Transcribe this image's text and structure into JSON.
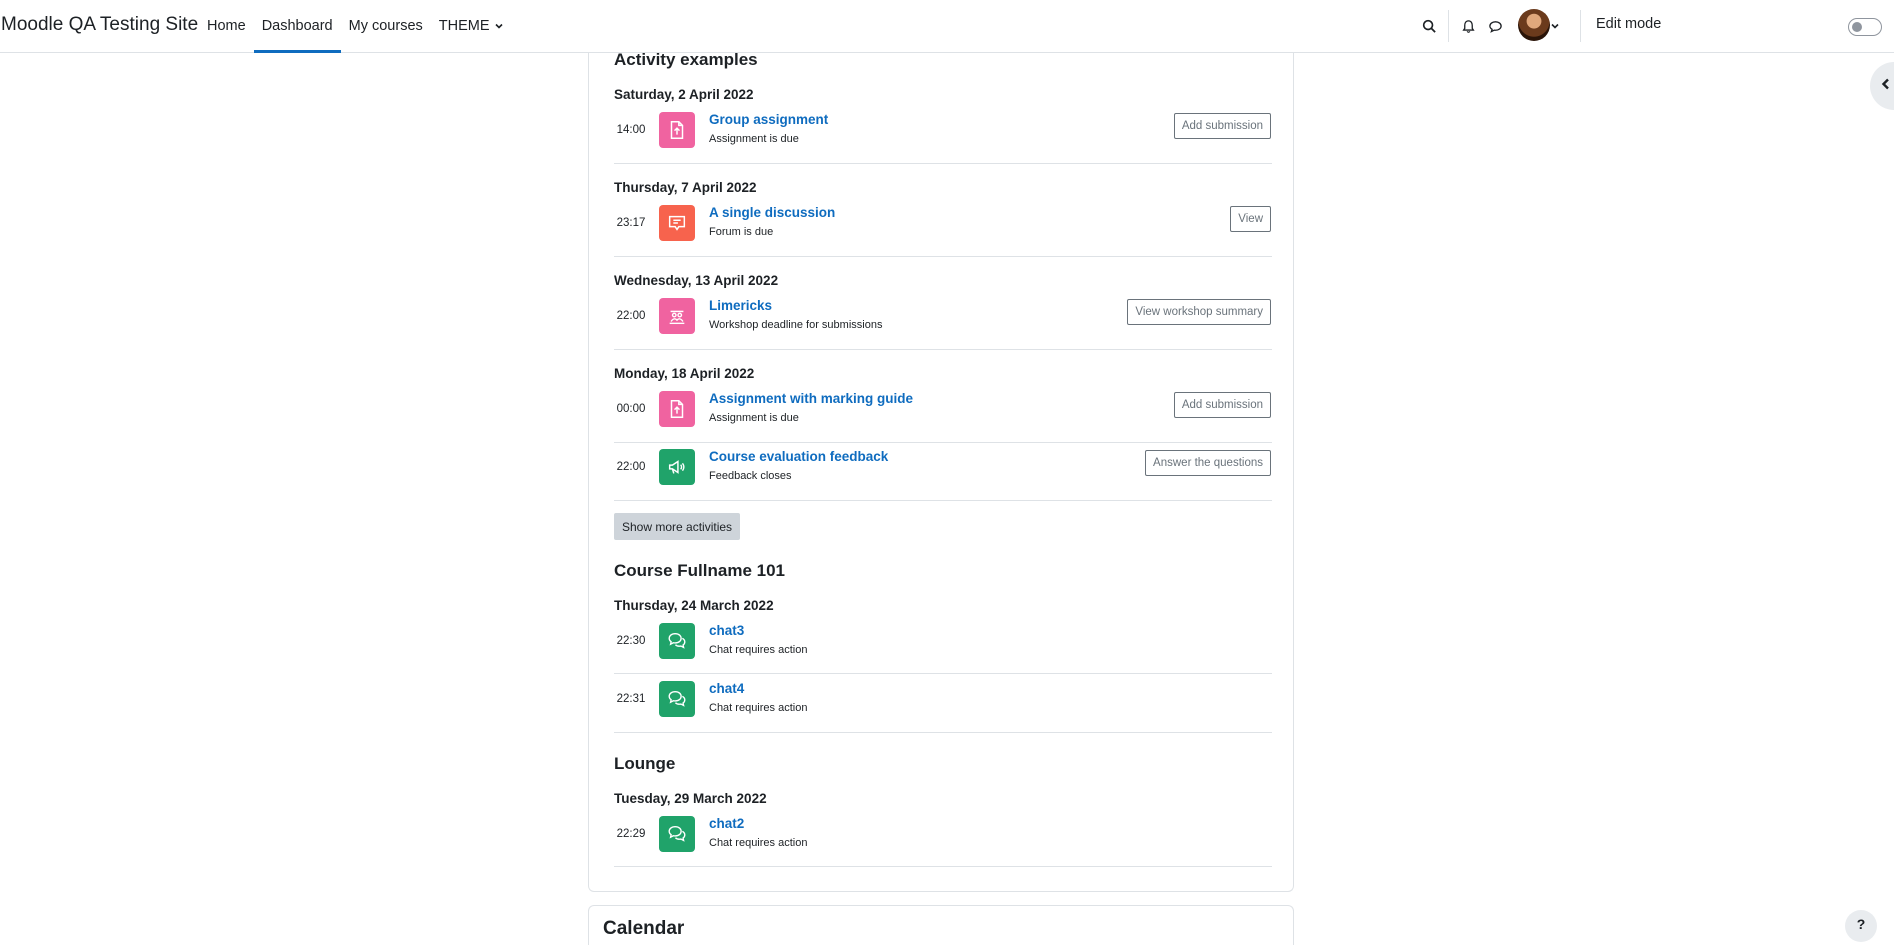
{
  "site_name": "Moodle QA Testing Site",
  "nav": {
    "items": [
      {
        "label": "Home",
        "active": false
      },
      {
        "label": "Dashboard",
        "active": true
      },
      {
        "label": "My courses",
        "active": false
      },
      {
        "label": "THEME",
        "active": false,
        "dropdown": true
      }
    ],
    "edit_mode_label": "Edit mode",
    "edit_mode_on": false
  },
  "colors": {
    "accent": "#0f6cbf",
    "assignment": "#f063a0",
    "forum": "#f7634d",
    "workshop": "#f063a0",
    "feedback": "#20a36a",
    "chat": "#20a36a"
  },
  "sections": [
    {
      "title": "Activity examples",
      "days": [
        {
          "date": "Saturday, 2 April 2022",
          "events": [
            {
              "time": "14:00",
              "icon": "assignment-icon",
              "name": "Group assignment",
              "desc": "Assignment is due",
              "action": "Add submission"
            }
          ]
        },
        {
          "date": "Thursday, 7 April 2022",
          "events": [
            {
              "time": "23:17",
              "icon": "forum-icon",
              "name": "A single discussion",
              "desc": "Forum is due",
              "action": "View"
            }
          ]
        },
        {
          "date": "Wednesday, 13 April 2022",
          "events": [
            {
              "time": "22:00",
              "icon": "workshop-icon",
              "name": "Limericks",
              "desc": "Workshop deadline for submissions",
              "action": "View workshop summary"
            }
          ]
        },
        {
          "date": "Monday, 18 April 2022",
          "events": [
            {
              "time": "00:00",
              "icon": "assignment-icon",
              "name": "Assignment with marking guide",
              "desc": "Assignment is due",
              "action": "Add submission"
            },
            {
              "time": "22:00",
              "icon": "feedback-icon",
              "name": "Course evaluation feedback",
              "desc": "Feedback closes",
              "action": "Answer the questions"
            }
          ]
        }
      ],
      "show_more": "Show more activities"
    },
    {
      "title": "Course Fullname 101",
      "days": [
        {
          "date": "Thursday, 24 March 2022",
          "events": [
            {
              "time": "22:30",
              "icon": "chat-icon",
              "name": "chat3",
              "desc": "Chat requires action"
            },
            {
              "time": "22:31",
              "icon": "chat-icon",
              "name": "chat4",
              "desc": "Chat requires action"
            }
          ]
        }
      ]
    },
    {
      "title": "Lounge",
      "days": [
        {
          "date": "Tuesday, 29 March 2022",
          "events": [
            {
              "time": "22:29",
              "icon": "chat-icon",
              "name": "chat2",
              "desc": "Chat requires action"
            }
          ]
        }
      ]
    }
  ],
  "next_block_title": "Calendar",
  "help_label": "?"
}
